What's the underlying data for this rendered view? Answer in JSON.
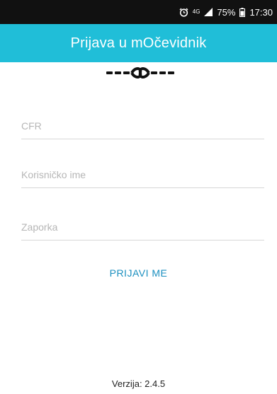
{
  "status_bar": {
    "network": "4G",
    "battery": "75%",
    "time": "17:30",
    "icons": [
      "alarm-icon",
      "network-4g-icon",
      "signal-icon",
      "battery-icon"
    ]
  },
  "app_bar": {
    "title": "Prijava u mOčevidnik"
  },
  "logo": {
    "icon": "chain-link-logo"
  },
  "form": {
    "cfr_placeholder": "CFR",
    "username_placeholder": "Korisničko ime",
    "password_placeholder": "Zaporka",
    "login_label": "PRIJAVI ME"
  },
  "footer": {
    "version": "Verzija: 2.4.5"
  },
  "colors": {
    "app_bar": "#20bed8",
    "accent": "#1a8fbf",
    "status_bar": "#111111"
  }
}
